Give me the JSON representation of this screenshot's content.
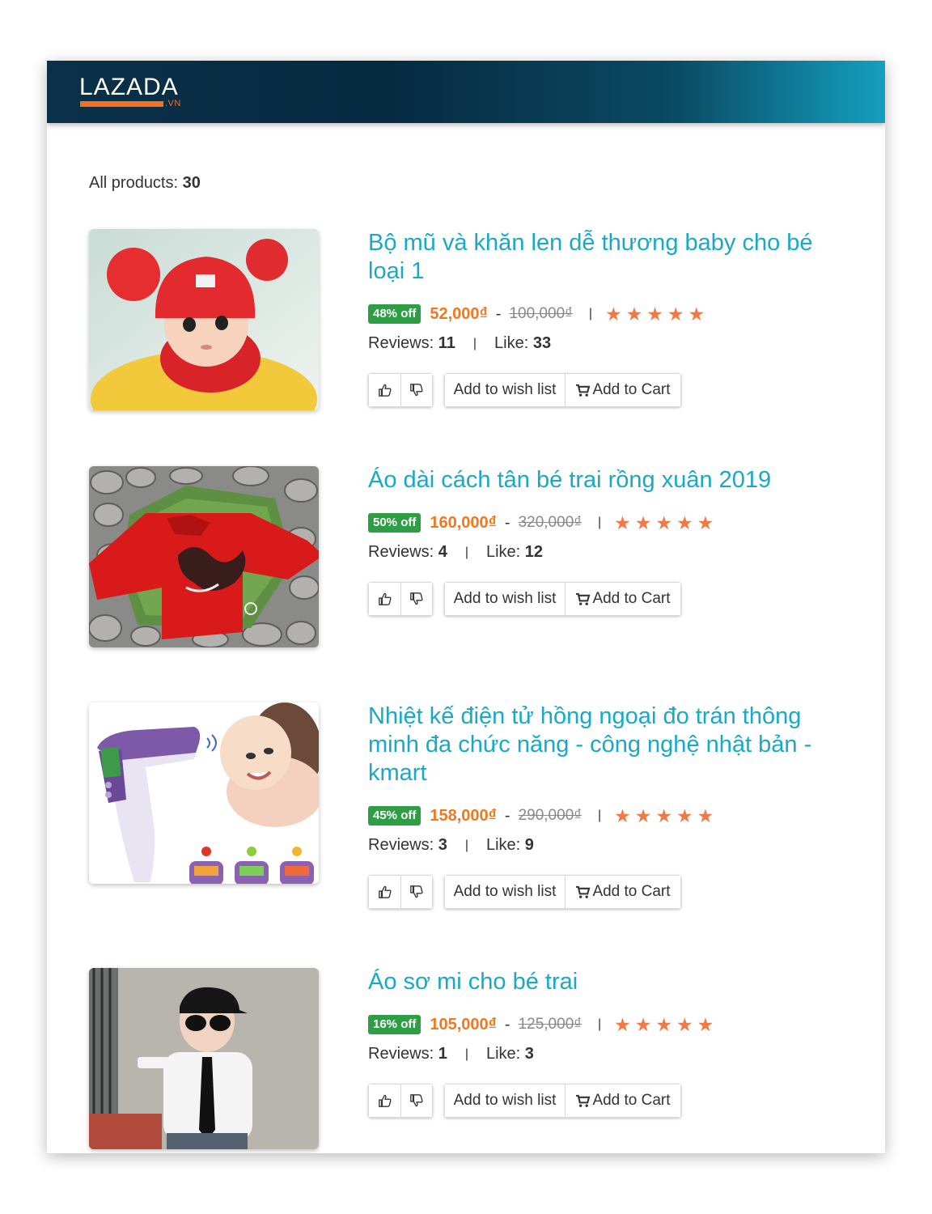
{
  "brand": {
    "name": "LAZADA",
    "sub": ".VN",
    "accent": "#f36f21"
  },
  "summary": {
    "label": "All products:",
    "count": "30"
  },
  "colors": {
    "title": "#18a9c6",
    "price": "#f07820",
    "badge": "#2e9e45",
    "star": "#f07a45"
  },
  "products": [
    {
      "title": "Bộ mũ và khăn len dễ thương baby cho bé loại 1",
      "discount": "48% off",
      "price": "52,000₫",
      "old_price": "100,000₫",
      "rating": 5,
      "reviews_label": "Reviews:",
      "reviews": "11",
      "likes_label": "Like:",
      "likes": "33",
      "wish_label": "Add to wish list",
      "cart_label": "Add to Cart"
    },
    {
      "title": "Áo dài cách tân bé trai rồng xuân 2019",
      "discount": "50% off",
      "price": "160,000₫",
      "old_price": "320,000₫",
      "rating": 5,
      "reviews_label": "Reviews:",
      "reviews": "4",
      "likes_label": "Like:",
      "likes": "12",
      "wish_label": "Add to wish list",
      "cart_label": "Add to Cart"
    },
    {
      "title": "Nhiệt kế điện tử hồng ngoại đo trán thông minh đa chức năng - công nghệ nhật bản - kmart",
      "discount": "45% off",
      "price": "158,000₫",
      "old_price": "290,000₫",
      "rating": 5,
      "reviews_label": "Reviews:",
      "reviews": "3",
      "likes_label": "Like:",
      "likes": "9",
      "wish_label": "Add to wish list",
      "cart_label": "Add to Cart"
    },
    {
      "title": "Áo sơ mi cho bé trai",
      "discount": "16% off",
      "price": "105,000₫",
      "old_price": "125,000₫",
      "rating": 5,
      "reviews_label": "Reviews:",
      "reviews": "1",
      "likes_label": "Like:",
      "likes": "3",
      "wish_label": "Add to wish list",
      "cart_label": "Add to Cart"
    }
  ]
}
